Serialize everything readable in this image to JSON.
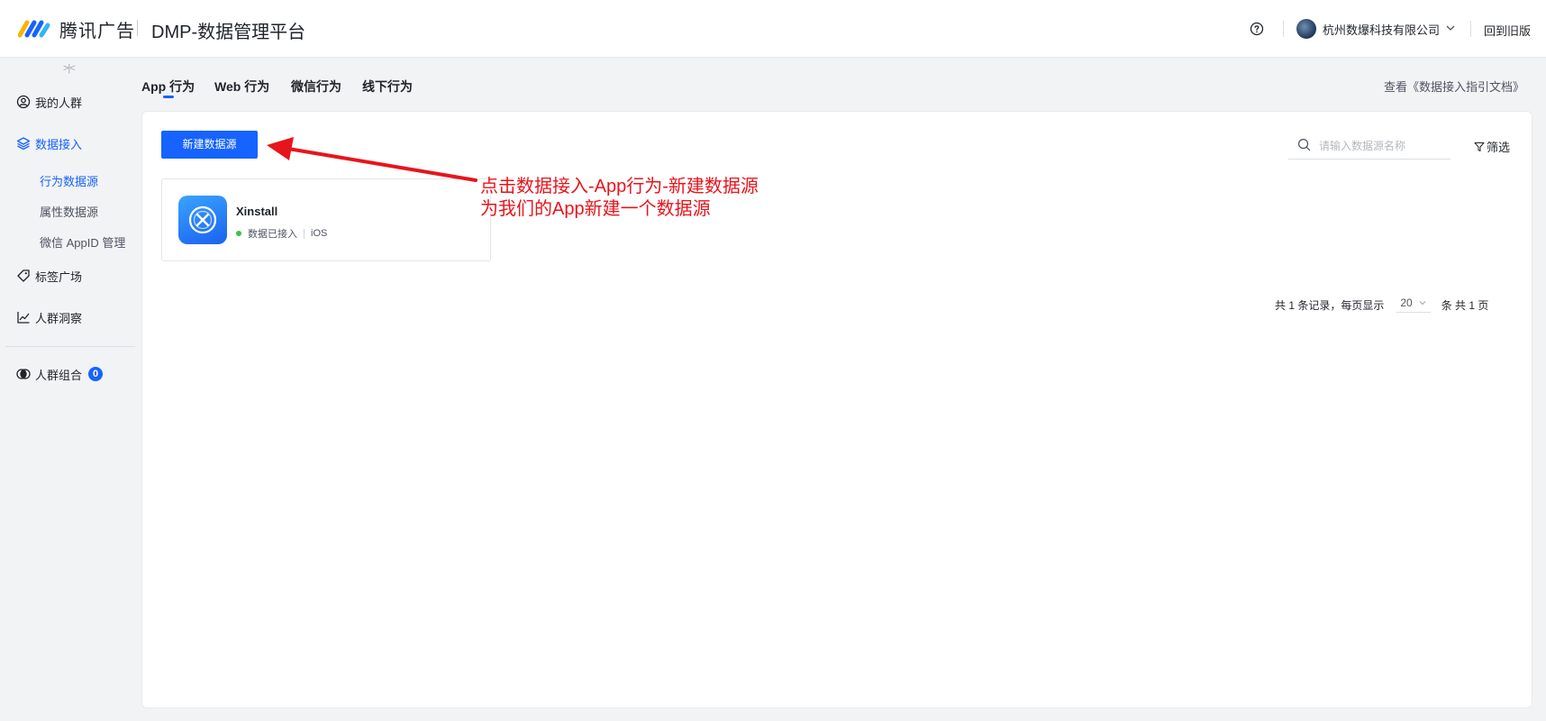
{
  "header": {
    "brand": "腾讯广告",
    "platform": "DMP-数据管理平台",
    "company": "杭州数爆科技有限公司",
    "old_version": "回到旧版"
  },
  "sidebar": {
    "collapse": ">|<",
    "items": [
      {
        "label": "我的人群",
        "icon": "user-circle-icon"
      },
      {
        "label": "数据接入",
        "icon": "layers-icon"
      },
      {
        "label": "标签广场",
        "icon": "tag-icon"
      },
      {
        "label": "人群洞察",
        "icon": "line-chart-icon"
      },
      {
        "label": "人群组合",
        "icon": "overlap-circles-icon",
        "badge": "0"
      }
    ],
    "sub_items": [
      "行为数据源",
      "属性数据源",
      "微信 AppID 管理"
    ]
  },
  "tabs": [
    "App 行为",
    "Web 行为",
    "微信行为",
    "线下行为"
  ],
  "doc_link": "查看《数据接入指引文档》",
  "toolbar": {
    "new_button": "新建数据源",
    "search_placeholder": "请输入数据源名称",
    "filter": "筛选"
  },
  "datasource_card": {
    "name": "Xinstall",
    "status": "数据已接入",
    "platform": "iOS"
  },
  "annotation": {
    "line1": "点击数据接入-App行为-新建数据源",
    "line2": "为我们的App新建一个数据源"
  },
  "pagination": {
    "summary": "共 1 条记录，每页显示",
    "page_size": "20",
    "suffix": "条 共 1 页"
  },
  "colors": {
    "primary": "#1663ff",
    "annotation": "#e8141c",
    "status_ok": "#3cc23c"
  }
}
